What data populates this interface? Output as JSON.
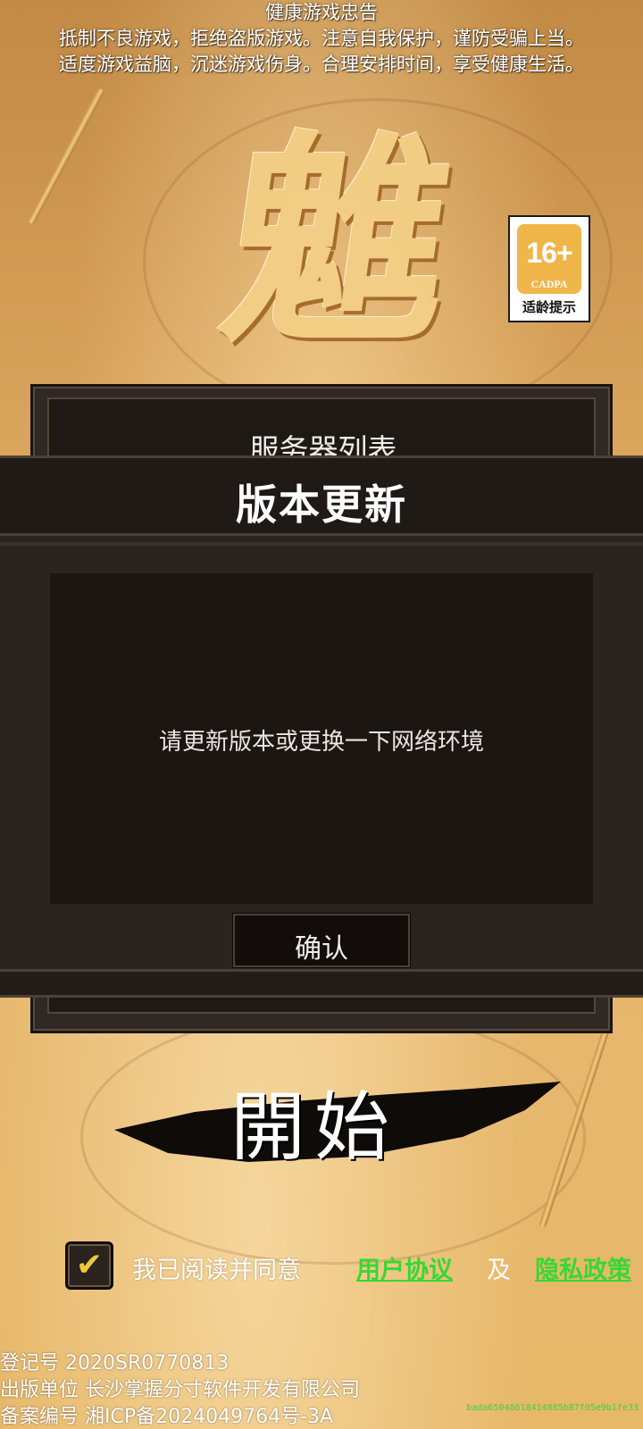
{
  "health_notice": {
    "title": "健康游戏忠告",
    "line1": "抵制不良游戏，拒绝盗版游戏。注意自我保护，谨防受骗上当。",
    "line2": "适度游戏益脑，沉迷游戏伤身。合理安排时间，享受健康生活。"
  },
  "game_logo": {
    "glyph": "魋"
  },
  "age_rating": {
    "age": "16+",
    "org": "CADPA",
    "caption": "适龄提示",
    "accent_color": "#f0b64a"
  },
  "server_panel": {
    "title": "服务器列表"
  },
  "update_dialog": {
    "title": "版本更新",
    "message": "请更新版本或更换一下网络环境",
    "confirm_label": "确认"
  },
  "start_button": {
    "label": "開始"
  },
  "agreement": {
    "checked": true,
    "text": "我已阅读并同意",
    "user_agreement": "用户协议",
    "and": "及",
    "privacy_policy": "隐私政策",
    "link_color": "#35d933"
  },
  "footer": {
    "registration": "登记号 2020SR0770813",
    "publisher": "出版单位 长沙掌握分寸软件开发有限公司",
    "icp": "备案编号 湘ICP备2024049764号-3A"
  },
  "build_id": "bada65048618414885b87f05e9b1fe33"
}
